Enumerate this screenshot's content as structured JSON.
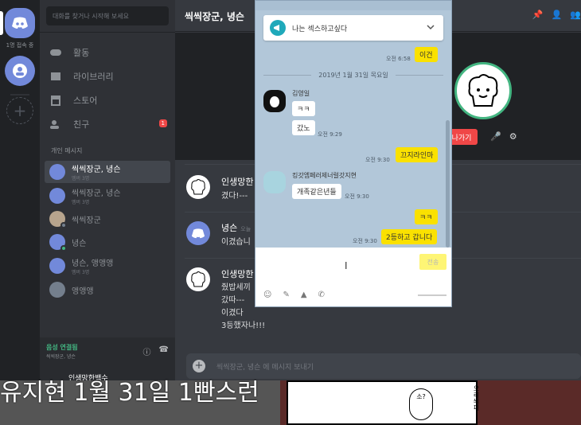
{
  "guilds": {
    "online_count": "1명 접속 중"
  },
  "sidebar": {
    "search_placeholder": "대화를 찾거나 시작해 보세요",
    "nav": [
      {
        "label": "활동"
      },
      {
        "label": "라이브러리"
      },
      {
        "label": "스토어"
      },
      {
        "label": "친구",
        "badge": "1"
      }
    ],
    "section_label": "개인 메시지",
    "dms": [
      {
        "name": "씩씩장군, 녕슨",
        "sub": "멤버 3명"
      },
      {
        "name": "씩씩장군, 녕슨",
        "sub": "멤버 3명"
      },
      {
        "name": "씩씩장군",
        "sub": ""
      },
      {
        "name": "녕슨",
        "sub": ""
      },
      {
        "name": "녕슨, 앵앵앵",
        "sub": "멤버 3명"
      },
      {
        "name": "앵앵앵",
        "sub": ""
      }
    ],
    "voice": {
      "status": "음성 연결됨",
      "channel": "씩씩장군, 녕슨"
    },
    "user": {
      "name": "인생망한백수"
    }
  },
  "header": {
    "title": "씩씩장군, 녕슨"
  },
  "voice_stage": {
    "leave_label": "나가기"
  },
  "messages": [
    {
      "author": "인생망한",
      "time": "",
      "lines": [
        "겼다!---"
      ]
    },
    {
      "author": "녕슨",
      "time": "오늘",
      "lines": [
        "이겼습니"
      ]
    },
    {
      "author": "인생망한",
      "time": "",
      "lines": [
        "줬밥세끼",
        "갔따---",
        "이겼다",
        "3등했자나!!!"
      ]
    }
  ],
  "composer": {
    "placeholder": "씩씩장군, 녕슨 에 메시지 보내기"
  },
  "caption": "유지현 1월 31일 1빤스런",
  "comic": {
    "bubble": "소?",
    "side_text": "오리씌피"
  },
  "kakao": {
    "notice": "나는 섹스하고싶다",
    "top_time": "오전 6:58",
    "top_msg": "이건",
    "date": "2019년 1월 31일 목요일",
    "sender1": "김영일",
    "msg_kk": "ㅋㅋ",
    "msg_gan": "갔노",
    "time_929": "오전 9:29",
    "my_msg1": "끄지라인마",
    "time_930": "오전 9:30",
    "sender2": "킹갓엠페러제너럴갓지현",
    "msg_dog": "개족같은년들",
    "my_msg2": "ㅋㅋ",
    "my_msg3": "2등하고 갑니다",
    "send_label": "전송"
  }
}
